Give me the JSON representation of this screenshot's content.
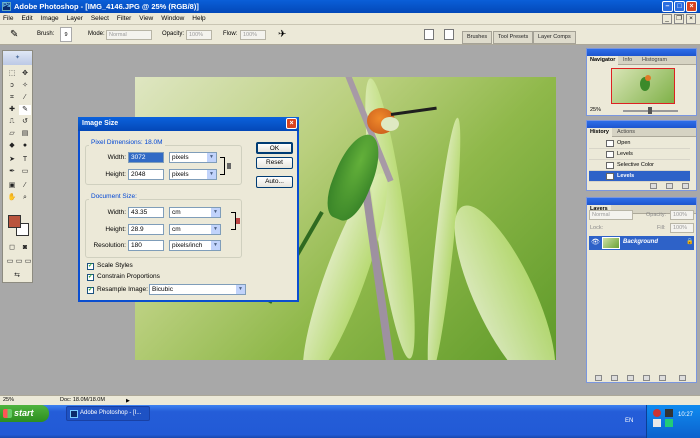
{
  "window": {
    "title": "Adobe Photoshop - [IMG_4146.JPG @ 25% (RGB/8)]",
    "app_icon": "Ps"
  },
  "menu": [
    "File",
    "Edit",
    "Image",
    "Layer",
    "Select",
    "Filter",
    "View",
    "Window",
    "Help"
  ],
  "options": {
    "brush_label": "Brush:",
    "brush_size": "9",
    "mode_label": "Mode:",
    "mode_value": "Normal",
    "opacity_label": "Opacity:",
    "opacity_value": "100%",
    "flow_label": "Flow:",
    "flow_value": "100%"
  },
  "palette_well": [
    "Brushes",
    "Tool Presets",
    "Layer Comps"
  ],
  "dialog": {
    "title": "Image Size",
    "pixel_dimensions": "Pixel Dimensions: 18.0M",
    "width_label": "Width:",
    "width_value": "3072",
    "width_unit": "pixels",
    "height_label": "Height:",
    "height_value": "2048",
    "height_unit": "pixels",
    "document_size": "Document Size:",
    "doc_width_value": "43.35",
    "doc_width_unit": "cm",
    "doc_height_value": "28.9",
    "doc_height_unit": "cm",
    "resolution_label": "Resolution:",
    "resolution_value": "180",
    "resolution_unit": "pixels/inch",
    "scale_styles": "Scale Styles",
    "constrain": "Constrain Proportions",
    "resample": "Resample Image:",
    "resample_value": "Bicubic",
    "ok": "OK",
    "reset": "Reset",
    "auto": "Auto..."
  },
  "navigator": {
    "tabs": [
      "Navigator",
      "Info",
      "Histogram"
    ],
    "zoom": "25%"
  },
  "history": {
    "tabs": [
      "History",
      "Actions"
    ],
    "items": [
      "Open",
      "Levels",
      "Selective Color",
      "Levels"
    ]
  },
  "layers": {
    "tab": "Layers",
    "blend_mode": "Normal",
    "opacity_label": "Opacity:",
    "opacity_value": "100%",
    "lock_label": "Lock:",
    "fill_label": "Fill:",
    "fill_value": "100%",
    "layer_name": "Background"
  },
  "status": {
    "zoom": "25%",
    "doc": "Doc: 18.0M/18.0M"
  },
  "taskbar": {
    "start": "start",
    "task": "Adobe Photoshop - [I...",
    "lang": "EN",
    "time": "10:27"
  }
}
